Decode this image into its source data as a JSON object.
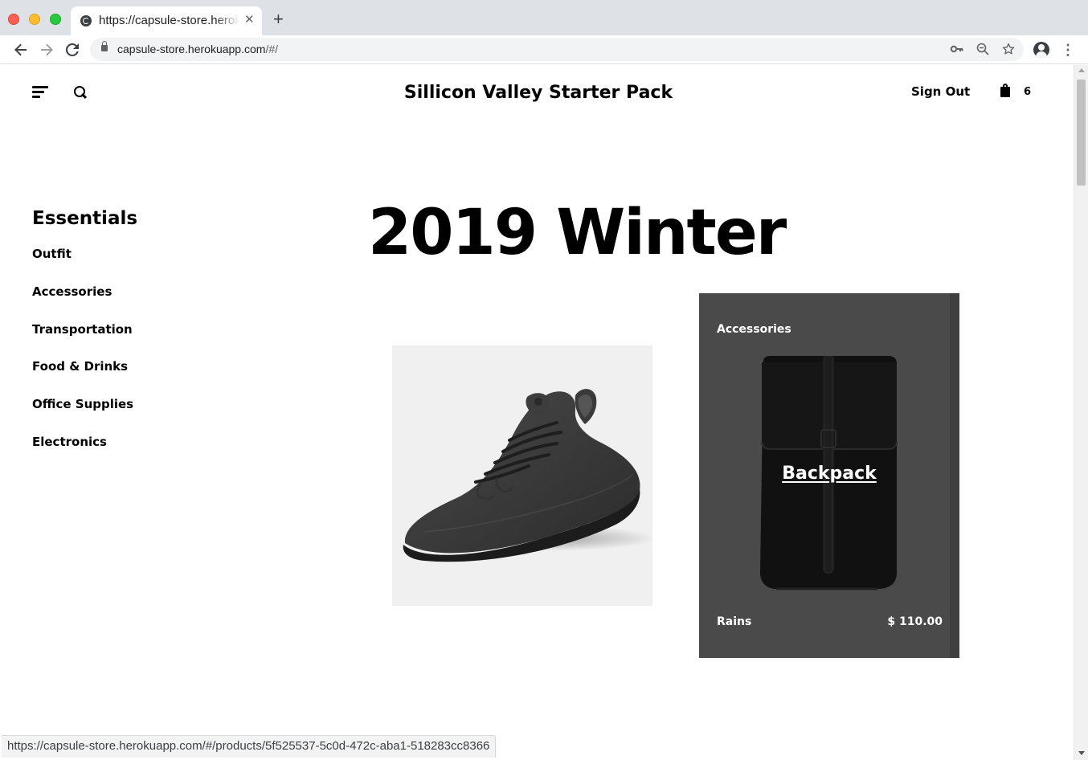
{
  "browser": {
    "tab_title": "https://capsule-store.herokuapp.com/#/",
    "tab_close": "✕",
    "new_tab": "+",
    "url_host": "capsule-store.herokuapp.com",
    "url_path": "/#/",
    "status_url": "https://capsule-store.herokuapp.com/#/products/5f525537-5c0d-472c-aba1-518283cc8366",
    "icons": [
      "back-arrow-icon",
      "forward-arrow-icon",
      "reload-icon",
      "lock-icon",
      "key-icon",
      "zoom-out-icon",
      "star-icon",
      "profile-icon",
      "more-menu-icon"
    ]
  },
  "header": {
    "site_title": "Sillicon Valley Starter Pack",
    "sign_out": "Sign Out",
    "cart_count": "6",
    "icons": [
      "hamburger-icon",
      "search-icon",
      "shopping-bag-icon"
    ]
  },
  "sidebar": {
    "heading": "Essentials",
    "items": [
      {
        "label": "Outfit"
      },
      {
        "label": "Accessories"
      },
      {
        "label": "Transportation"
      },
      {
        "label": "Food & Drinks"
      },
      {
        "label": "Office Supplies"
      },
      {
        "label": "Electronics"
      }
    ]
  },
  "main": {
    "collection_title": "2019 Winter",
    "products": [
      {
        "image": "wool-runner-shoe"
      },
      {
        "category": "Accessories",
        "name": "Backpack",
        "brand": "Rains",
        "price": "$ 110.00",
        "image": "backpack",
        "card_color": "#4a4a4a"
      }
    ]
  }
}
